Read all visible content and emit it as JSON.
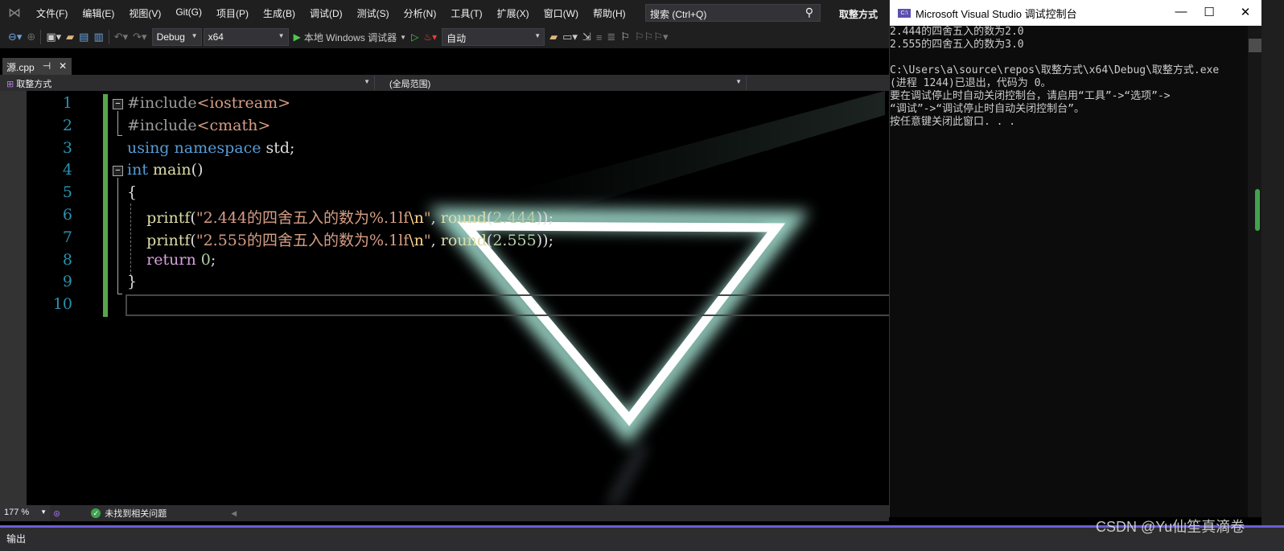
{
  "menubar": {
    "items": [
      "文件(F)",
      "编辑(E)",
      "视图(V)",
      "Git(G)",
      "项目(P)",
      "生成(B)",
      "调试(D)",
      "测试(S)",
      "分析(N)",
      "工具(T)",
      "扩展(X)",
      "窗口(W)",
      "帮助(H)"
    ],
    "search_placeholder": "搜索 (Ctrl+Q)",
    "solution_title": "取整方式"
  },
  "toolbar": {
    "config": "Debug",
    "platform": "x64",
    "run_label": "本地 Windows 调试器",
    "stack_frame": "自动"
  },
  "tab": {
    "label": "源.cpp",
    "pin": "⊣",
    "close": "✕"
  },
  "navbar": {
    "project": "取整方式",
    "scope": "(全局范围)"
  },
  "editor": {
    "line_numbers": [
      "1",
      "2",
      "3",
      "4",
      "5",
      "6",
      "7",
      "8",
      "9",
      "10"
    ],
    "lines": [
      [
        {
          "t": "#include",
          "c": "pp"
        },
        {
          "t": "<iostream>",
          "c": "inc"
        }
      ],
      [
        {
          "t": "#include",
          "c": "pp"
        },
        {
          "t": "<cmath>",
          "c": "inc"
        }
      ],
      [
        {
          "t": "using",
          "c": "kw"
        },
        {
          "t": " "
        },
        {
          "t": "namespace",
          "c": "kw"
        },
        {
          "t": " std;"
        }
      ],
      [
        {
          "t": "int",
          "c": "kw"
        },
        {
          "t": " "
        },
        {
          "t": "main",
          "c": "fn"
        },
        {
          "t": "()"
        }
      ],
      [
        {
          "t": "{"
        }
      ],
      [
        {
          "t": "    "
        },
        {
          "t": "printf",
          "c": "fn"
        },
        {
          "t": "("
        },
        {
          "t": "\"2.444的四舍五入的数为%.1lf",
          "c": "str"
        },
        {
          "t": "\\n",
          "c": "esc"
        },
        {
          "t": "\"",
          "c": "str"
        },
        {
          "t": ", "
        },
        {
          "t": "round",
          "c": "fn"
        },
        {
          "t": "("
        },
        {
          "t": "2.444",
          "c": "num"
        },
        {
          "t": "));"
        }
      ],
      [
        {
          "t": "    "
        },
        {
          "t": "printf",
          "c": "fn"
        },
        {
          "t": "("
        },
        {
          "t": "\"2.555的四舍五入的数为%.1lf",
          "c": "str"
        },
        {
          "t": "\\n",
          "c": "esc"
        },
        {
          "t": "\"",
          "c": "str"
        },
        {
          "t": ", "
        },
        {
          "t": "round",
          "c": "fn"
        },
        {
          "t": "("
        },
        {
          "t": "2.555",
          "c": "num"
        },
        {
          "t": "));"
        }
      ],
      [
        {
          "t": "    "
        },
        {
          "t": "return",
          "c": "ctl"
        },
        {
          "t": " "
        },
        {
          "t": "0",
          "c": "num"
        },
        {
          "t": ";"
        }
      ],
      [
        {
          "t": "}"
        }
      ],
      [
        {
          "t": ""
        }
      ]
    ]
  },
  "statusbar": {
    "zoom": "177 %",
    "issues": "未找到相关问题"
  },
  "output": {
    "label": "输出"
  },
  "console": {
    "title": "Microsoft Visual Studio 调试控制台",
    "icon_text": "C:\\",
    "lines": [
      "2.444的四舍五入的数为2.0",
      "2.555的四舍五入的数为3.0",
      "",
      "C:\\Users\\a\\source\\repos\\取整方式\\x64\\Debug\\取整方式.exe",
      "(进程 1244)已退出，代码为 0。",
      "要在调试停止时自动关闭控制台，请启用“工具”->“选项”->",
      "“调试”->“调试停止时自动关闭控制台”。",
      "按任意键关闭此窗口. . ."
    ]
  },
  "watermark": "CSDN @Yu仙笙真滴卷"
}
